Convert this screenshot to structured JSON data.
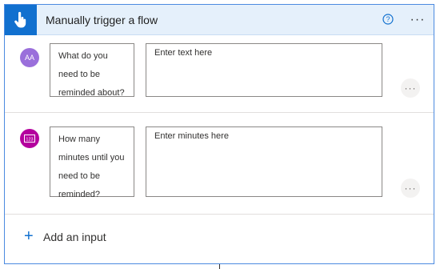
{
  "header": {
    "title": "Manually trigger a flow",
    "icon": "hand-touch-icon",
    "help_icon": "help-circle-icon",
    "more_label": "···"
  },
  "inputs": [
    {
      "type_icon": "text-type-icon",
      "type_glyph": "AA",
      "label": "What do you need to be reminded about?",
      "placeholder": "Enter text here",
      "more_label": "···",
      "avatar_color": "#9a6fdb"
    },
    {
      "type_icon": "number-type-icon",
      "type_glyph": "123",
      "label": "How many minutes until you need to be reminded?",
      "placeholder": "Enter minutes here",
      "more_label": "···",
      "avatar_color": "#b4009e"
    }
  ],
  "add_input": {
    "label": "Add an input",
    "icon": "plus-icon"
  },
  "colors": {
    "accent": "#1170cf",
    "header_bg": "#e5f0fb",
    "card_border": "#4c8ae0"
  }
}
